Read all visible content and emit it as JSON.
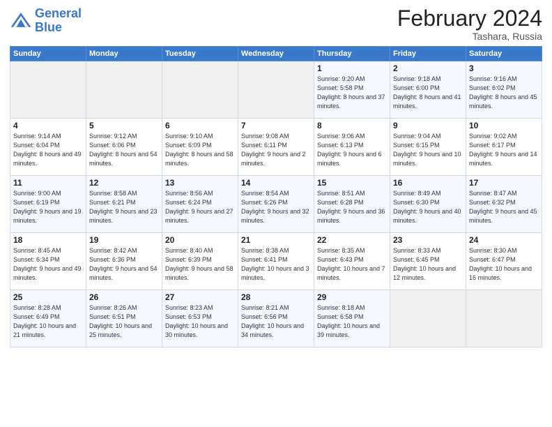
{
  "header": {
    "logo_line1": "General",
    "logo_line2": "Blue",
    "month_title": "February 2024",
    "location": "Tashara, Russia"
  },
  "days_of_week": [
    "Sunday",
    "Monday",
    "Tuesday",
    "Wednesday",
    "Thursday",
    "Friday",
    "Saturday"
  ],
  "weeks": [
    [
      {
        "num": "",
        "sunrise": "",
        "sunset": "",
        "daylight": "",
        "empty": true
      },
      {
        "num": "",
        "sunrise": "",
        "sunset": "",
        "daylight": "",
        "empty": true
      },
      {
        "num": "",
        "sunrise": "",
        "sunset": "",
        "daylight": "",
        "empty": true
      },
      {
        "num": "",
        "sunrise": "",
        "sunset": "",
        "daylight": "",
        "empty": true
      },
      {
        "num": "1",
        "sunrise": "Sunrise: 9:20 AM",
        "sunset": "Sunset: 5:58 PM",
        "daylight": "Daylight: 8 hours and 37 minutes."
      },
      {
        "num": "2",
        "sunrise": "Sunrise: 9:18 AM",
        "sunset": "Sunset: 6:00 PM",
        "daylight": "Daylight: 8 hours and 41 minutes."
      },
      {
        "num": "3",
        "sunrise": "Sunrise: 9:16 AM",
        "sunset": "Sunset: 6:02 PM",
        "daylight": "Daylight: 8 hours and 45 minutes."
      }
    ],
    [
      {
        "num": "4",
        "sunrise": "Sunrise: 9:14 AM",
        "sunset": "Sunset: 6:04 PM",
        "daylight": "Daylight: 8 hours and 49 minutes."
      },
      {
        "num": "5",
        "sunrise": "Sunrise: 9:12 AM",
        "sunset": "Sunset: 6:06 PM",
        "daylight": "Daylight: 8 hours and 54 minutes."
      },
      {
        "num": "6",
        "sunrise": "Sunrise: 9:10 AM",
        "sunset": "Sunset: 6:09 PM",
        "daylight": "Daylight: 8 hours and 58 minutes."
      },
      {
        "num": "7",
        "sunrise": "Sunrise: 9:08 AM",
        "sunset": "Sunset: 6:11 PM",
        "daylight": "Daylight: 9 hours and 2 minutes."
      },
      {
        "num": "8",
        "sunrise": "Sunrise: 9:06 AM",
        "sunset": "Sunset: 6:13 PM",
        "daylight": "Daylight: 9 hours and 6 minutes."
      },
      {
        "num": "9",
        "sunrise": "Sunrise: 9:04 AM",
        "sunset": "Sunset: 6:15 PM",
        "daylight": "Daylight: 9 hours and 10 minutes."
      },
      {
        "num": "10",
        "sunrise": "Sunrise: 9:02 AM",
        "sunset": "Sunset: 6:17 PM",
        "daylight": "Daylight: 9 hours and 14 minutes."
      }
    ],
    [
      {
        "num": "11",
        "sunrise": "Sunrise: 9:00 AM",
        "sunset": "Sunset: 6:19 PM",
        "daylight": "Daylight: 9 hours and 19 minutes."
      },
      {
        "num": "12",
        "sunrise": "Sunrise: 8:58 AM",
        "sunset": "Sunset: 6:21 PM",
        "daylight": "Daylight: 9 hours and 23 minutes."
      },
      {
        "num": "13",
        "sunrise": "Sunrise: 8:56 AM",
        "sunset": "Sunset: 6:24 PM",
        "daylight": "Daylight: 9 hours and 27 minutes."
      },
      {
        "num": "14",
        "sunrise": "Sunrise: 8:54 AM",
        "sunset": "Sunset: 6:26 PM",
        "daylight": "Daylight: 9 hours and 32 minutes."
      },
      {
        "num": "15",
        "sunrise": "Sunrise: 8:51 AM",
        "sunset": "Sunset: 6:28 PM",
        "daylight": "Daylight: 9 hours and 36 minutes."
      },
      {
        "num": "16",
        "sunrise": "Sunrise: 8:49 AM",
        "sunset": "Sunset: 6:30 PM",
        "daylight": "Daylight: 9 hours and 40 minutes."
      },
      {
        "num": "17",
        "sunrise": "Sunrise: 8:47 AM",
        "sunset": "Sunset: 6:32 PM",
        "daylight": "Daylight: 9 hours and 45 minutes."
      }
    ],
    [
      {
        "num": "18",
        "sunrise": "Sunrise: 8:45 AM",
        "sunset": "Sunset: 6:34 PM",
        "daylight": "Daylight: 9 hours and 49 minutes."
      },
      {
        "num": "19",
        "sunrise": "Sunrise: 8:42 AM",
        "sunset": "Sunset: 6:36 PM",
        "daylight": "Daylight: 9 hours and 54 minutes."
      },
      {
        "num": "20",
        "sunrise": "Sunrise: 8:40 AM",
        "sunset": "Sunset: 6:39 PM",
        "daylight": "Daylight: 9 hours and 58 minutes."
      },
      {
        "num": "21",
        "sunrise": "Sunrise: 8:38 AM",
        "sunset": "Sunset: 6:41 PM",
        "daylight": "Daylight: 10 hours and 3 minutes."
      },
      {
        "num": "22",
        "sunrise": "Sunrise: 8:35 AM",
        "sunset": "Sunset: 6:43 PM",
        "daylight": "Daylight: 10 hours and 7 minutes."
      },
      {
        "num": "23",
        "sunrise": "Sunrise: 8:33 AM",
        "sunset": "Sunset: 6:45 PM",
        "daylight": "Daylight: 10 hours and 12 minutes."
      },
      {
        "num": "24",
        "sunrise": "Sunrise: 8:30 AM",
        "sunset": "Sunset: 6:47 PM",
        "daylight": "Daylight: 10 hours and 16 minutes."
      }
    ],
    [
      {
        "num": "25",
        "sunrise": "Sunrise: 8:28 AM",
        "sunset": "Sunset: 6:49 PM",
        "daylight": "Daylight: 10 hours and 21 minutes."
      },
      {
        "num": "26",
        "sunrise": "Sunrise: 8:26 AM",
        "sunset": "Sunset: 6:51 PM",
        "daylight": "Daylight: 10 hours and 25 minutes."
      },
      {
        "num": "27",
        "sunrise": "Sunrise: 8:23 AM",
        "sunset": "Sunset: 6:53 PM",
        "daylight": "Daylight: 10 hours and 30 minutes."
      },
      {
        "num": "28",
        "sunrise": "Sunrise: 8:21 AM",
        "sunset": "Sunset: 6:56 PM",
        "daylight": "Daylight: 10 hours and 34 minutes."
      },
      {
        "num": "29",
        "sunrise": "Sunrise: 8:18 AM",
        "sunset": "Sunset: 6:58 PM",
        "daylight": "Daylight: 10 hours and 39 minutes."
      },
      {
        "num": "",
        "sunrise": "",
        "sunset": "",
        "daylight": "",
        "empty": true
      },
      {
        "num": "",
        "sunrise": "",
        "sunset": "",
        "daylight": "",
        "empty": true
      }
    ]
  ]
}
